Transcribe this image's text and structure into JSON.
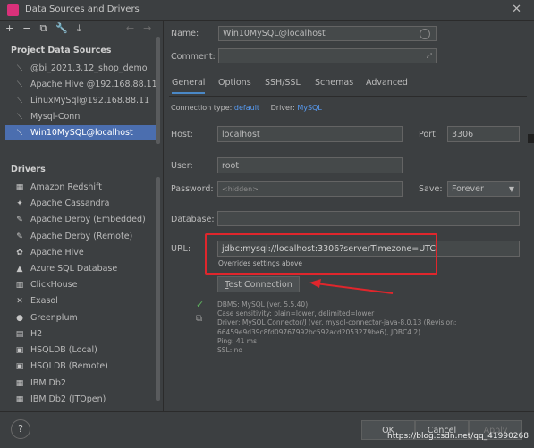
{
  "window": {
    "title": "Data Sources and Drivers"
  },
  "toolbar": {
    "icons": [
      "plus",
      "minus",
      "copy",
      "wrench",
      "import"
    ],
    "nav": [
      "←",
      "→"
    ]
  },
  "project": {
    "heading": "Project Data Sources",
    "items": [
      {
        "label": "@bi_2021.3.12_shop_demo",
        "icon": "sql-icon"
      },
      {
        "label": "Apache Hive  @192.168.88.11",
        "icon": "sql-icon"
      },
      {
        "label": "LinuxMySql@192.168.88.11",
        "icon": "sql-icon"
      },
      {
        "label": "Mysql-Conn",
        "icon": "sql-icon"
      },
      {
        "label": "Win10MySQL@localhost",
        "icon": "sql-icon",
        "selected": true
      }
    ]
  },
  "drivers": {
    "heading": "Drivers",
    "items": [
      {
        "label": "Amazon Redshift",
        "glyph": "▦"
      },
      {
        "label": "Apache Cassandra",
        "glyph": "✦"
      },
      {
        "label": "Apache Derby (Embedded)",
        "glyph": "✎"
      },
      {
        "label": "Apache Derby (Remote)",
        "glyph": "✎"
      },
      {
        "label": "Apache Hive",
        "glyph": "✿"
      },
      {
        "label": "Azure SQL Database",
        "glyph": "▲"
      },
      {
        "label": "ClickHouse",
        "glyph": "▥"
      },
      {
        "label": "Exasol",
        "glyph": "✕"
      },
      {
        "label": "Greenplum",
        "glyph": "●"
      },
      {
        "label": "H2",
        "glyph": "▤"
      },
      {
        "label": "HSQLDB (Local)",
        "glyph": "▣"
      },
      {
        "label": "HSQLDB (Remote)",
        "glyph": "▣"
      },
      {
        "label": "IBM Db2",
        "glyph": "▦"
      },
      {
        "label": "IBM Db2 (JTOpen)",
        "glyph": "▦"
      }
    ]
  },
  "form": {
    "name_label": "Name:",
    "name_value": "Win10MySQL@localhost",
    "comment_label": "Comment:",
    "tabs": [
      "General",
      "Options",
      "SSH/SSL",
      "Schemas",
      "Advanced"
    ],
    "conn_type_label": "Connection type:",
    "conn_type_value": "default",
    "driver_label": "Driver:",
    "driver_value": "MySQL",
    "host_label": "Host:",
    "host_value": "localhost",
    "port_label": "Port:",
    "port_value": "3306",
    "user_label": "User:",
    "user_value": "root",
    "password_label": "Password:",
    "password_value": "<hidden>",
    "save_label": "Save:",
    "save_value": "Forever",
    "database_label": "Database:",
    "database_value": "",
    "url_label": "URL:",
    "url_value": "jdbc:mysql://localhost:3306?serverTimezone=UTC",
    "url_hint": "Overrides settings above",
    "test_button": "Test Connection",
    "test_button_underline": "T",
    "test_button_rest": "est Connection",
    "result_lines": [
      "DBMS: MySQL (ver. 5.5.40)",
      "Case sensitivity: plain=lower, delimited=lower",
      "Driver: MySQL Connector/J (ver. mysql-connector-java-8.0.13 (Revision:",
      "66459e9d39c8fd09767992bc592acd2053279be6), JDBC4.2)",
      "Ping: 41 ms",
      "SSL: no"
    ]
  },
  "bottom": {
    "help": "?",
    "ok": "OK",
    "cancel": "Cancel",
    "apply": "Apply",
    "watermark": "https://blog.csdn.net/qq_41990268"
  },
  "colors": {
    "accent": "#4b6eaf",
    "highlight": "#e0262c",
    "link": "#589df6",
    "bg": "#3c3f41"
  }
}
